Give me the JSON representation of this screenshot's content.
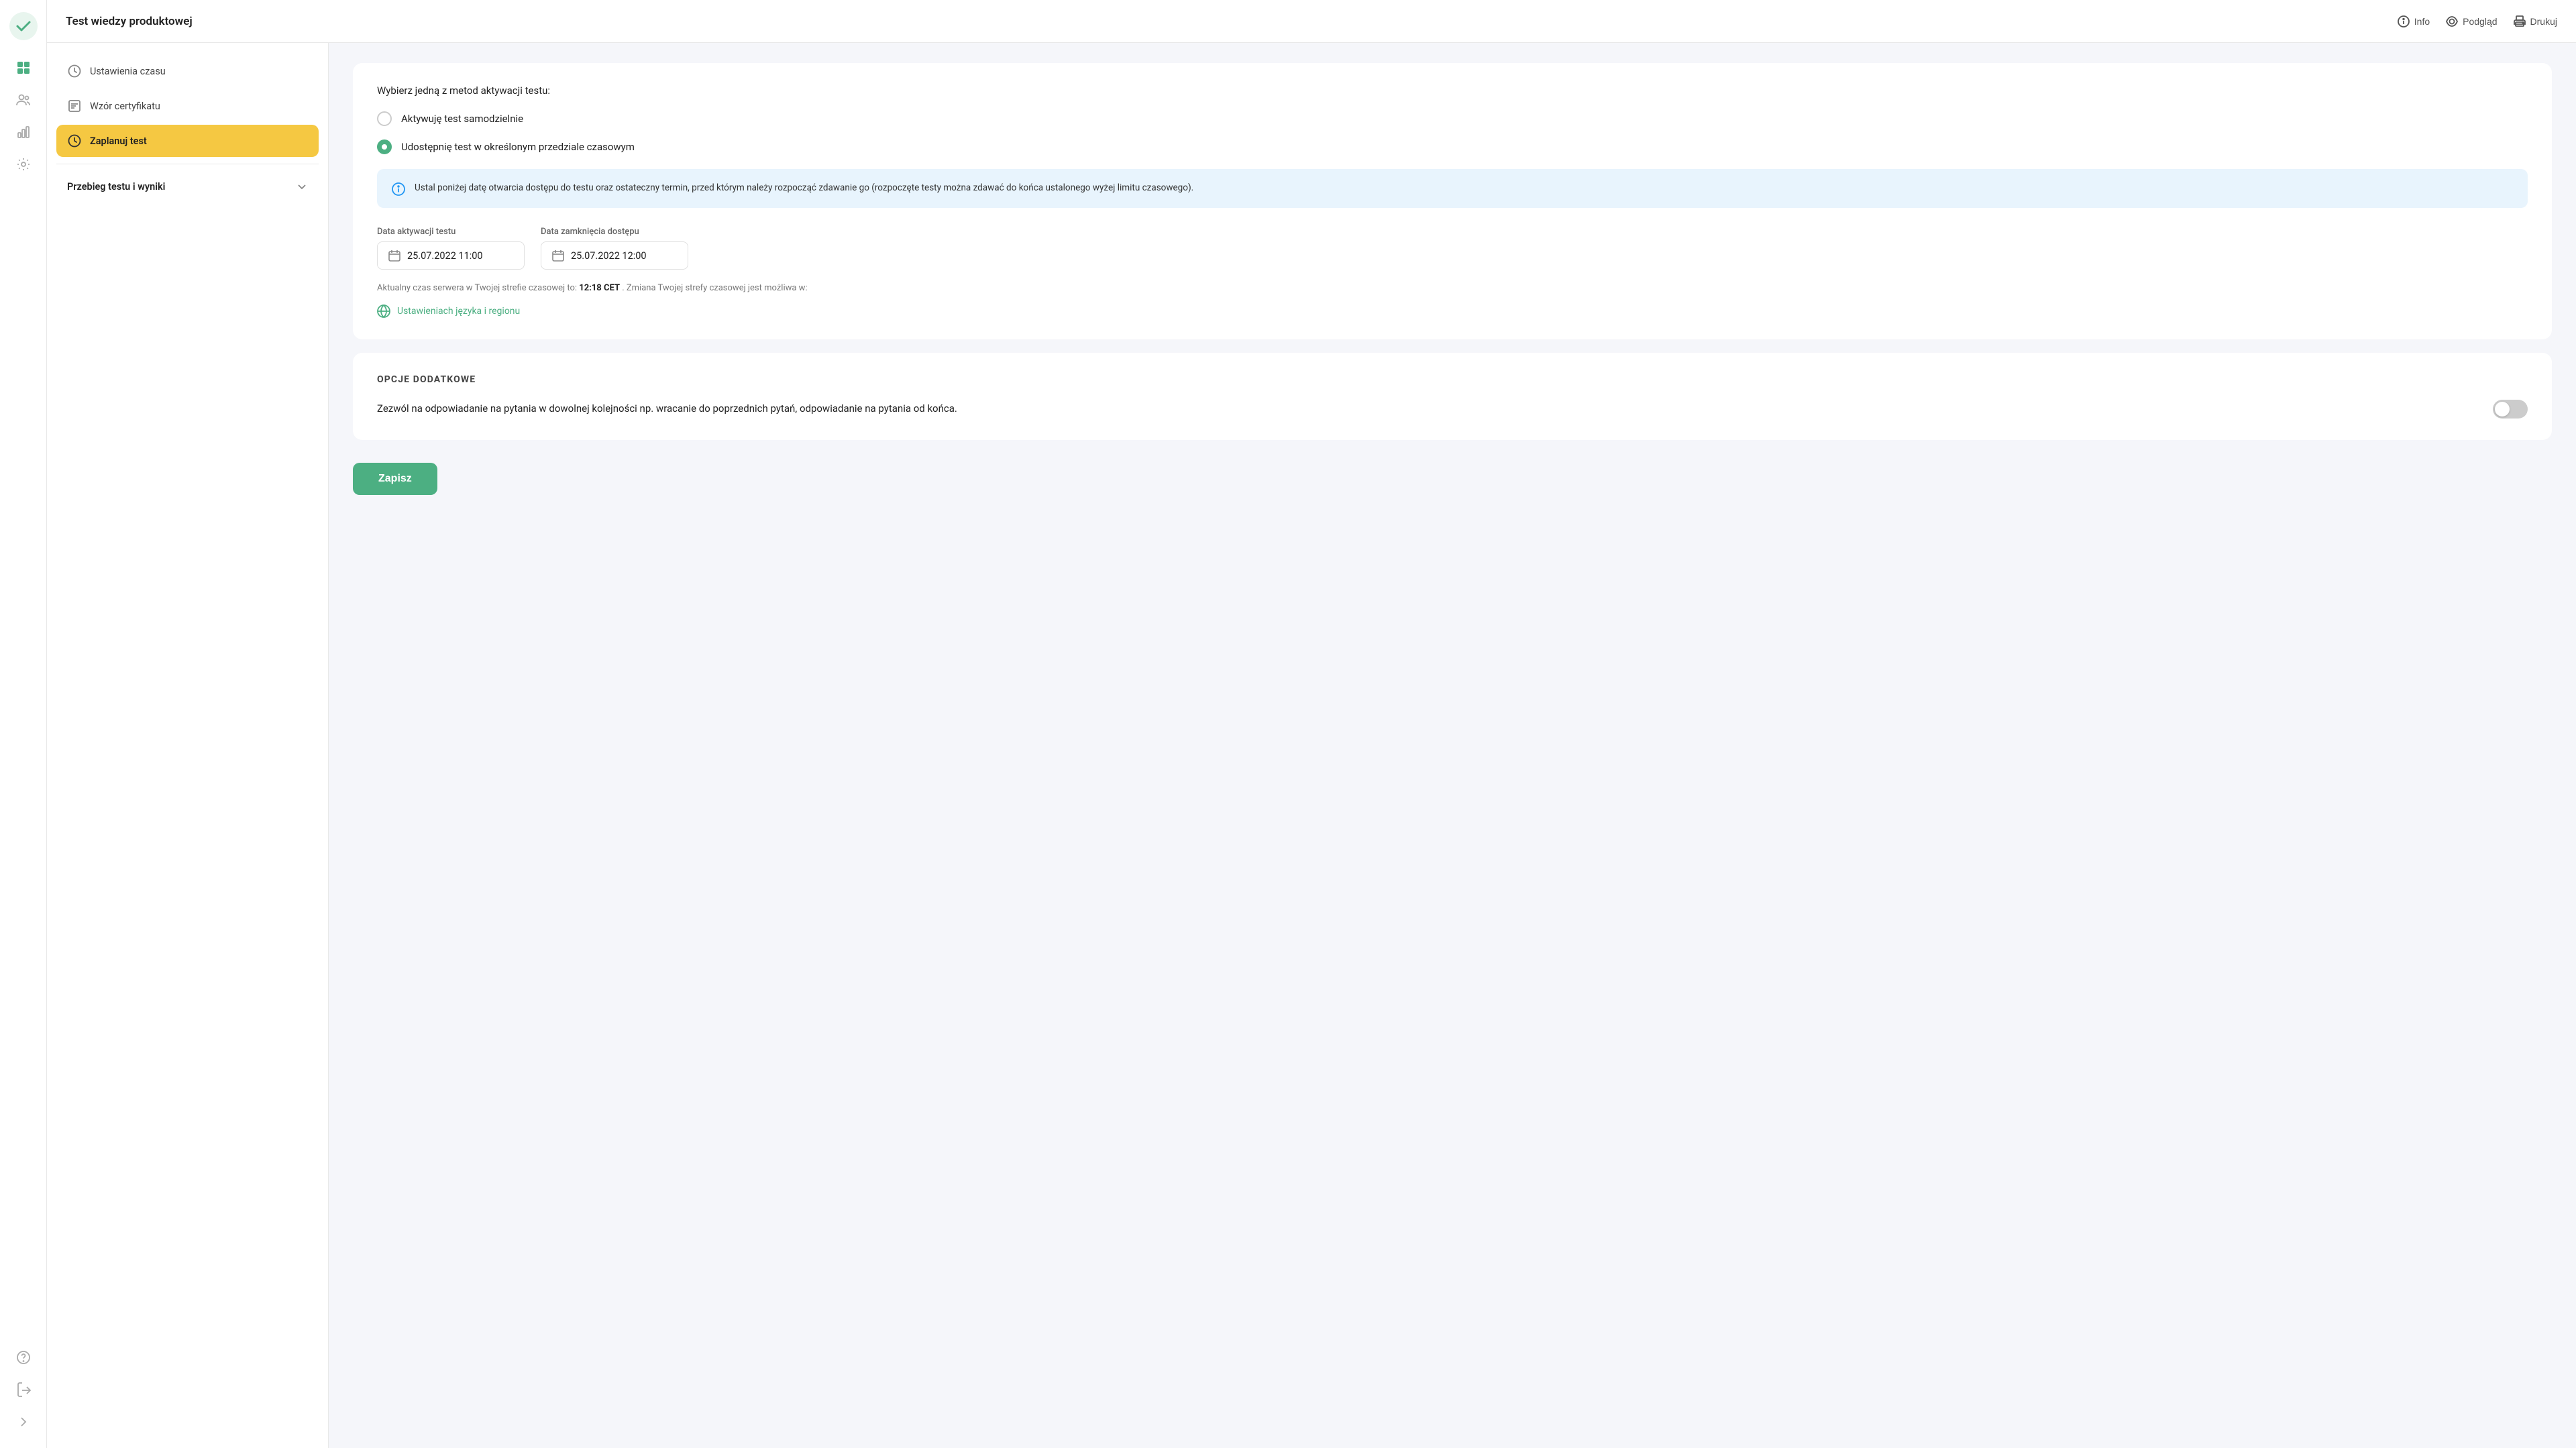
{
  "header": {
    "title": "Test wiedzy produktowej",
    "actions": {
      "info": "Info",
      "preview": "Podgląd",
      "print": "Drukuj"
    }
  },
  "sidebar": {
    "icons": [
      "grid",
      "users",
      "chart",
      "settings"
    ],
    "bottom_icons": [
      "help",
      "logout",
      "expand"
    ]
  },
  "left_nav": {
    "items": [
      {
        "id": "ustawienia-czasu",
        "label": "Ustawienia czasu",
        "icon": "clock"
      },
      {
        "id": "wzor-certyfikatu",
        "label": "Wzór certyfikatu",
        "icon": "certificate"
      }
    ],
    "active_item": {
      "id": "zaplanuj-test",
      "label": "Zaplanuj test",
      "icon": "clock"
    },
    "section": {
      "label": "Przebieg testu i wyniki"
    }
  },
  "main": {
    "activation_section": {
      "intro": "Wybierz jedną z metod aktywacji testu:",
      "options": [
        {
          "id": "opt1",
          "label": "Aktywuję test samodzielnie",
          "checked": false
        },
        {
          "id": "opt2",
          "label": "Udostępnię test w określonym przedziale czasowym",
          "checked": true
        }
      ]
    },
    "info_box": {
      "text": "Ustal poniżej datę otwarcia dostępu do testu oraz ostateczny termin, przed którym należy rozpocząć zdawanie go (rozpoczęte testy można zdawać do końca ustalonego wyżej limitu czasowego)."
    },
    "date_fields": {
      "activation": {
        "label": "Data aktywacji testu",
        "value": "25.07.2022 11:00"
      },
      "closing": {
        "label": "Data zamknięcia dostępu",
        "value": "25.07.2022 12:00"
      }
    },
    "server_time": {
      "prefix": "Aktualny czas serwera w Twojej strefie czasowej to:",
      "time": "12:18 CET",
      "suffix": ". Zmiana Twojej strefy czasowej jest możliwa w:"
    },
    "language_link": "Ustawieniach języka i regionu",
    "additional_options": {
      "title": "OPCJE DODATKOWE",
      "toggle_label": "Zezwól na odpowiadanie na pytania w dowolnej kolejności np. wracanie do poprzednich pytań, odpowiadanie na pytania od końca.",
      "toggle_on": false
    },
    "save_button": "Zapisz"
  }
}
